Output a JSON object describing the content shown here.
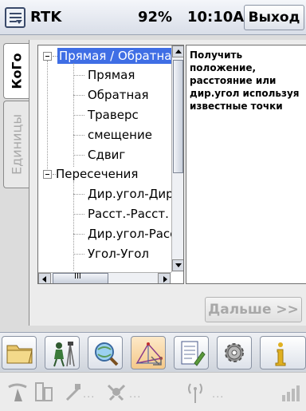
{
  "titlebar": {
    "mode": "RTK",
    "battery": "92%",
    "time": "10:10A",
    "exit_label": "Выход",
    "menu_icon": "start-menu-icon"
  },
  "tabs": [
    {
      "label": "КоГо",
      "active": true
    },
    {
      "label": "Единицы",
      "active": false
    }
  ],
  "tree": {
    "items": [
      {
        "label": "Прямая / Обратная",
        "level": 0,
        "expanded": true,
        "selected": true
      },
      {
        "label": "Прямая",
        "level": 1
      },
      {
        "label": "Обратная",
        "level": 1
      },
      {
        "label": "Траверс",
        "level": 1
      },
      {
        "label": "смещение",
        "level": 1
      },
      {
        "label": "Сдвиг",
        "level": 1
      },
      {
        "label": "Пересечения",
        "level": 0,
        "expanded": true
      },
      {
        "label": "Дир.угол-Дир.угол",
        "level": 1
      },
      {
        "label": "Расст.-Расст.",
        "level": 1
      },
      {
        "label": "Дир.угол-Расст.",
        "level": 1
      },
      {
        "label": "Угол-Угол",
        "level": 1
      }
    ],
    "hscroll_mark": "III"
  },
  "description": "Получить положение, расстояние или дир.угол используя известные точки",
  "next_button": {
    "label": "Дальше >>",
    "enabled": false
  },
  "toolbar": {
    "tools": [
      {
        "icon": "folder-icon"
      },
      {
        "icon": "surveyor-icon"
      },
      {
        "icon": "magnifier-globe-icon"
      },
      {
        "icon": "cogo-geometry-icon"
      },
      {
        "icon": "notepad-icon"
      },
      {
        "icon": "settings-gear-icon"
      },
      {
        "icon": "info-icon"
      }
    ]
  },
  "statusbar": {
    "icons": [
      "receiver-icon",
      "battery-icon",
      "cable-connection-icon",
      "satellite-icon",
      "radio-antenna-icon",
      "signal-bars-icon"
    ],
    "placeholder": "..."
  },
  "colors": {
    "selection": "#3f6ee5",
    "disabled_text": "#a8a8a8",
    "toolbar_gradient_top": "#eef0f4"
  }
}
